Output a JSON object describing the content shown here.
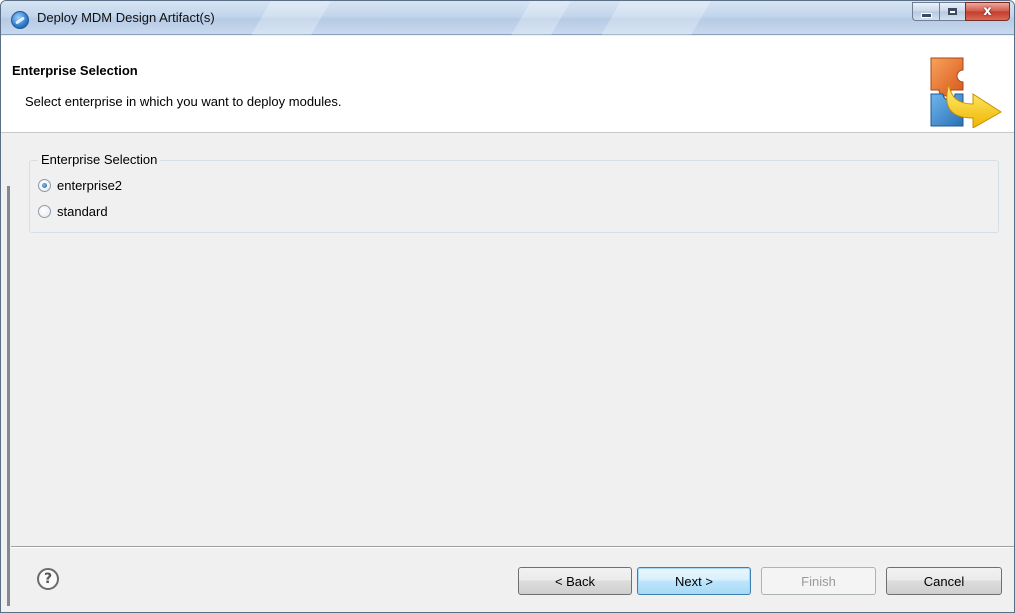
{
  "window": {
    "title": "Deploy MDM Design Artifact(s)",
    "app_icon": "eclipse-icon",
    "controls": {
      "minimize_icon": "minimize-icon",
      "maximize_icon": "maximize-icon",
      "close_label": "x"
    }
  },
  "banner": {
    "title": "Enterprise Selection",
    "description": "Select enterprise in which you want to deploy modules.",
    "icon": "deploy-puzzle-icon"
  },
  "group": {
    "legend": "Enterprise Selection",
    "options": [
      {
        "label": "enterprise2",
        "checked": true
      },
      {
        "label": "standard",
        "checked": false
      }
    ]
  },
  "footer": {
    "help_label": "?",
    "buttons": {
      "back": "< Back",
      "next": "Next >",
      "finish": "Finish",
      "cancel": "Cancel"
    }
  },
  "colors": {
    "dialog_bg": "#f0f0f0",
    "banner_bg": "#ffffff",
    "default_button": "#bee6fd"
  }
}
